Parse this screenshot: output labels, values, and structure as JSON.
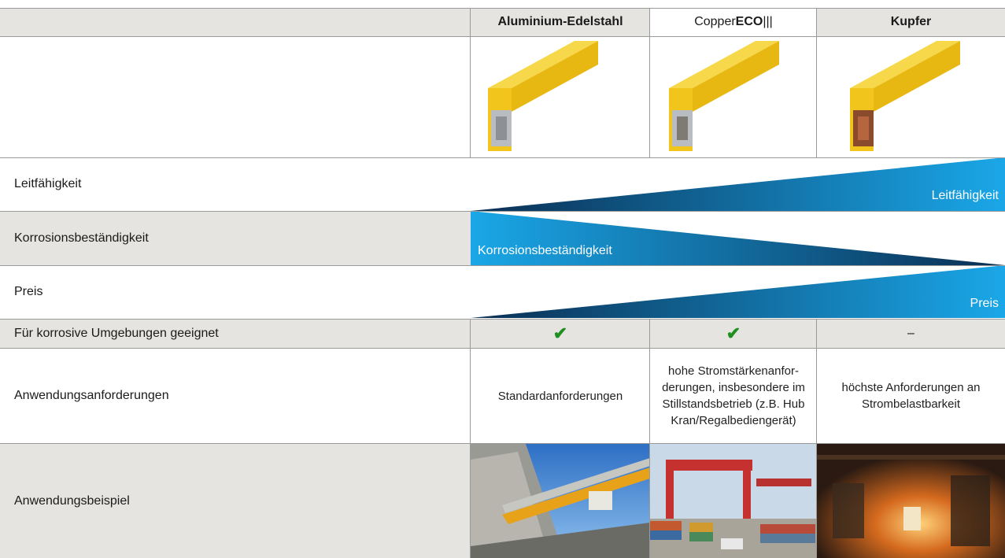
{
  "header": {
    "col1": "Aluminium-Edelstahl",
    "col2_prefix": "Copper",
    "col2_bold": "ECO",
    "col2_suffix": " |||",
    "col3": "Kupfer"
  },
  "rows": {
    "conductivity": {
      "label": "Leitfähigkeit",
      "bar_label": "Leitfähigkeit"
    },
    "corrosion": {
      "label": "Korrosionsbeständigkeit",
      "bar_label": "Korrosionsbeständigkeit"
    },
    "price": {
      "label": "Preis",
      "bar_label": "Preis"
    },
    "corrosive_env": {
      "label": "Für korrosive Umgebungen geeignet",
      "col1": "✔",
      "col2": "✔",
      "col3": "–"
    },
    "requirements": {
      "label": "Anwendungsanforderungen",
      "col1": "Standardanforderungen",
      "col2": "hohe Stromstärkenanfor-derungen, insbesondere im Stillstandsbetrieb (z.B. Hub Kran/Regalbediengerät)",
      "col3": "höchste Anforderungen an Strombelastbarkeit"
    },
    "example": {
      "label": "Anwendungsbeispiel"
    }
  },
  "colors": {
    "grey_bg": "#e5e4e0",
    "wedge_light": "#1aa7e8",
    "wedge_dark": "#0a2e52",
    "rail_yellow": "#f2c51c",
    "check_green": "#1f8f1f"
  }
}
